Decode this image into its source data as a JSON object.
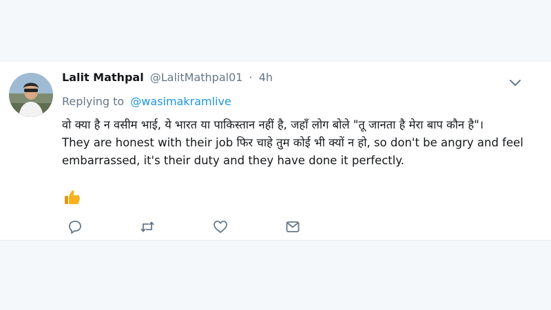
{
  "tweet": {
    "display_name": "Lalit Mathpal",
    "handle": "@LalitMathpal01",
    "separator": "·",
    "time": "4h",
    "replying_prefix": "Replying to",
    "replying_to": "@wasimakramlive",
    "body_line_1": "वो क्या है न वसीम भाई, ये भारत या पाकिस्तान नहीं है, जहाँ लोग बोले \"तू जानता है मेरा बाप कौन है\"।",
    "body_line_2": "They are honest with their job फिर चाहे तुम कोई भी क्यों न हो, so don't be angry and feel embarrassed, it's their duty and they have done it perfectly.",
    "emoji": "thumbs-up-icon"
  },
  "actions": [
    "reply-icon",
    "retweet-icon",
    "like-icon",
    "direct-message-icon"
  ],
  "colors": {
    "background": "#f5f8fa",
    "card": "#ffffff",
    "text": "#14171a",
    "muted": "#657786",
    "link": "#1b95e0",
    "emoji": "#f7b21f"
  }
}
